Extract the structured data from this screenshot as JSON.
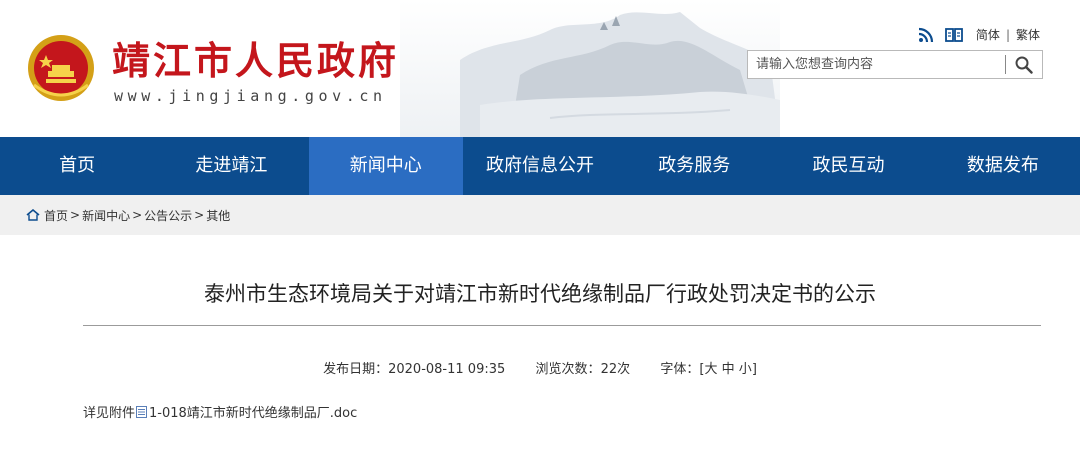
{
  "site": {
    "title": "靖江市人民政府",
    "domain": "www.jingjiang.gov.cn"
  },
  "topbar": {
    "simplified": "简体",
    "divider": "|",
    "traditional": "繁体"
  },
  "search": {
    "placeholder": "请输入您想查询内容"
  },
  "nav": {
    "items": [
      "首页",
      "走进靖江",
      "新闻中心",
      "政府信息公开",
      "政务服务",
      "政民互动",
      "数据发布"
    ],
    "active_index": 2
  },
  "breadcrumb": {
    "items": [
      "首页",
      "新闻中心",
      "公告公示",
      "其他"
    ],
    "separator": ">"
  },
  "article": {
    "title": "泰州市生态环境局关于对靖江市新时代绝缘制品厂行政处罚决定书的公示",
    "publish_label": "发布日期：",
    "publish_date": "2020-08-11 09:35",
    "views_label": "浏览次数：",
    "views": "22次",
    "font_label": "字体：",
    "font_open": "[",
    "font_large": "大",
    "font_medium": "中",
    "font_small": "小",
    "font_close": "]",
    "attachment_prefix": "详见附件",
    "attachment_name": "1-018靖江市新时代绝缘制品厂.doc"
  },
  "colors": {
    "brand_red": "#c4161c",
    "nav_bg": "#0c4c8e",
    "nav_active": "#2b6dc2",
    "crumb_bg": "#f0f0f0"
  },
  "icons": [
    "national-emblem-icon",
    "rss-icon",
    "reader-icon",
    "search-icon",
    "home-icon",
    "doc-file-icon"
  ]
}
